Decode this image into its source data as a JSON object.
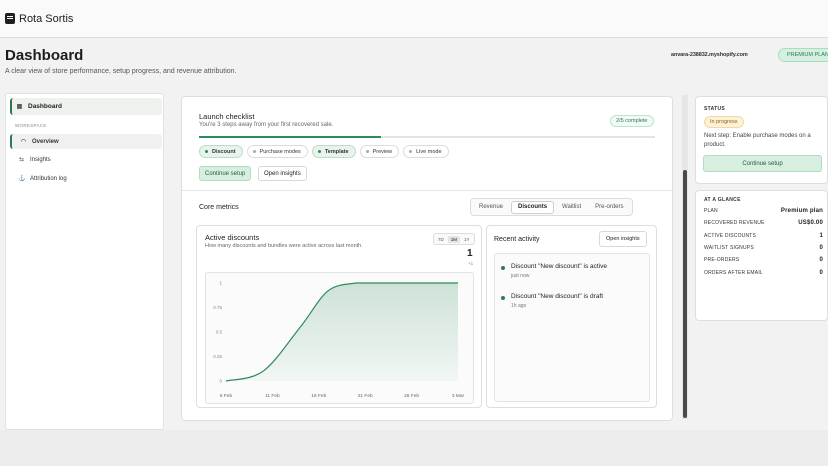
{
  "app": {
    "name": "Rota Sortis"
  },
  "header": {
    "title": "Dashboard",
    "subtitle": "A clear view of store performance, setup progress, and revenue attribution.",
    "store": "anvara-238832.myshopify.com",
    "plan_badge": "PREMIUM PLAN"
  },
  "sidebar": {
    "dashboard_label": "Dashboard",
    "section_label": "WORKSPACE",
    "items": [
      {
        "label": "Overview",
        "icon": "gauge-icon",
        "active": true
      },
      {
        "label": "Insights",
        "icon": "list-icon",
        "active": false
      },
      {
        "label": "Attribution log",
        "icon": "anchor-icon",
        "active": false
      }
    ]
  },
  "checklist": {
    "title": "Launch checklist",
    "subtitle": "You're 3 steps away from your first recovered sale.",
    "badge": "2/5 complete",
    "progress": 0.4,
    "steps": [
      {
        "label": "Discount",
        "done": true
      },
      {
        "label": "Purchase modes",
        "done": false
      },
      {
        "label": "Template",
        "done": true
      },
      {
        "label": "Preview",
        "done": false
      },
      {
        "label": "Live mode",
        "done": false
      }
    ],
    "continue_label": "Continue setup",
    "insights_label": "Open insights"
  },
  "core_metrics": {
    "title": "Core metrics",
    "tabs": [
      "Revenue",
      "Discounts",
      "Waitlist",
      "Pre-orders"
    ],
    "active_tab": 1
  },
  "metric_card": {
    "title": "Active discounts",
    "subtitle": "How many discounts and bundles were active across last month.",
    "ranges": [
      "7D",
      "1M",
      "1Y"
    ],
    "active_range": 1,
    "value": "1",
    "delta": "+1"
  },
  "chart_data": {
    "type": "area",
    "title": "Active discounts",
    "x": [
      "6 Feb",
      "11 Feb",
      "16 Feb",
      "21 Feb",
      "26 Feb",
      "3 Mar"
    ],
    "y_ticks": [
      "0",
      "0.25",
      "0.5",
      "0.75",
      "1"
    ],
    "ylim": [
      0,
      1
    ],
    "series": [
      {
        "x": [
          0,
          4,
          8,
          11,
          14,
          15,
          25
        ],
        "values": [
          0,
          0.1,
          0.55,
          0.92,
          1,
          1,
          1
        ]
      }
    ],
    "color": "#2e8b5c",
    "grid": false
  },
  "activity": {
    "title": "Recent activity",
    "button": "Open insights",
    "items": [
      {
        "text": "Discount \"New discount\" is active",
        "time": "just now"
      },
      {
        "text": "Discount \"New discount\" is draft",
        "time": "1h ago"
      }
    ]
  },
  "status": {
    "head": "STATUS",
    "pill": "In progress",
    "next_step": "Next step: Enable purchase modes on a product.",
    "button": "Continue setup"
  },
  "glance": {
    "head": "AT A GLANCE",
    "rows": [
      {
        "label": "PLAN",
        "value": "Premium plan"
      },
      {
        "label": "RECOVERED REVENUE",
        "value": "US$0.00"
      },
      {
        "label": "ACTIVE DISCOUNTS",
        "value": "1"
      },
      {
        "label": "WAITLIST SIGNUPS",
        "value": "0"
      },
      {
        "label": "PRE-ORDERS",
        "value": "0"
      },
      {
        "label": "ORDERS AFTER EMAIL",
        "value": "0"
      }
    ]
  }
}
